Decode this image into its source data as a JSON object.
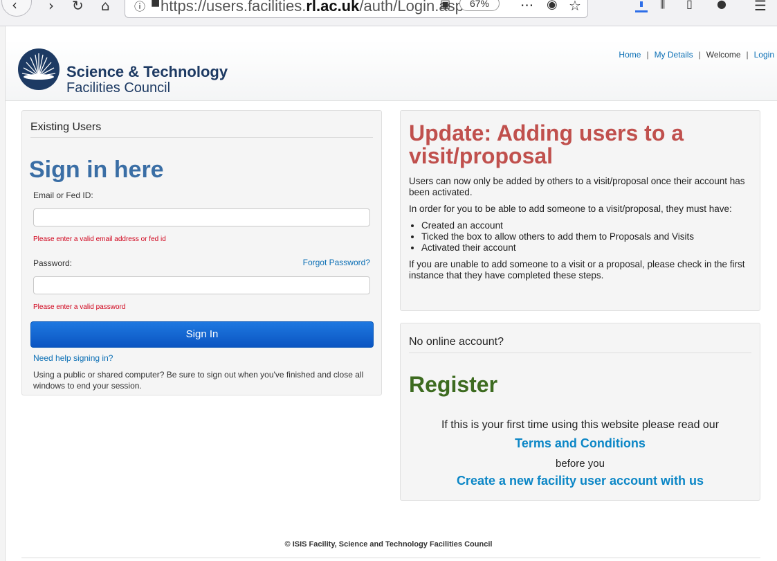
{
  "browser": {
    "url_prefix": "https://users.facilities.",
    "url_domain": "rl.ac.uk",
    "url_suffix": "/auth/Login.asp",
    "zoom": "67%",
    "icons": [
      "back-icon",
      "forward-icon",
      "reload-icon",
      "home-icon",
      "info-icon",
      "lock-icon",
      "reader-icon",
      "more-icon",
      "pocket-icon",
      "bookmark-star-icon",
      "download-icon",
      "library-icon",
      "sidebar-icon",
      "account-icon",
      "menu-icon"
    ]
  },
  "header": {
    "logo_title": "Science & Technology",
    "logo_subtitle": "Facilities Council",
    "nav": {
      "home": "Home",
      "my_details": "My Details",
      "welcome": "Welcome",
      "login": "Login",
      "separator": "|"
    }
  },
  "signin": {
    "section_label": "Existing Users",
    "heading": "Sign in here",
    "email_label": "Email or Fed ID:",
    "email_value": "",
    "email_error": "Please enter a valid email address or fed id",
    "password_label": "Password:",
    "password_value": "",
    "forgot_link": "Forgot Password?",
    "password_error": "Please enter a valid password",
    "button_label": "Sign In",
    "help_link": "Need help signing in?",
    "note": "Using a public or shared computer? Be sure to sign out when you've finished and close all windows to end your session."
  },
  "update": {
    "heading": "Update: Adding users to a visit/proposal",
    "para1": "Users can now only be added by others to a visit/proposal once their account has been activated.",
    "para2": "In order for you to be able to add someone to a visit/proposal, they must have:",
    "items": [
      "Created an account",
      "Ticked the box to allow others to add them to Proposals and Visits",
      "Activated their account"
    ],
    "para3": "If you are unable to add someone to a visit or a proposal, please check in the first instance that they have completed these steps."
  },
  "register": {
    "section_label": "No online account?",
    "heading": "Register",
    "line1": "If this is your first time using this website please read our",
    "terms_link": "Terms and Conditions",
    "line2": "before you",
    "create_link": "Create a new facility user account with us"
  },
  "footer": {
    "text": "© ISIS Facility, Science and Technology Facilities Council"
  },
  "colors": {
    "brand_navy": "#1d3a63",
    "sign_in_blue": "#3a6ea5",
    "update_red": "#c0504d",
    "register_green": "#3d6b20",
    "link_blue": "#0b6fb5",
    "error_red": "#d0021b",
    "button_blue": "#0b55c2"
  }
}
